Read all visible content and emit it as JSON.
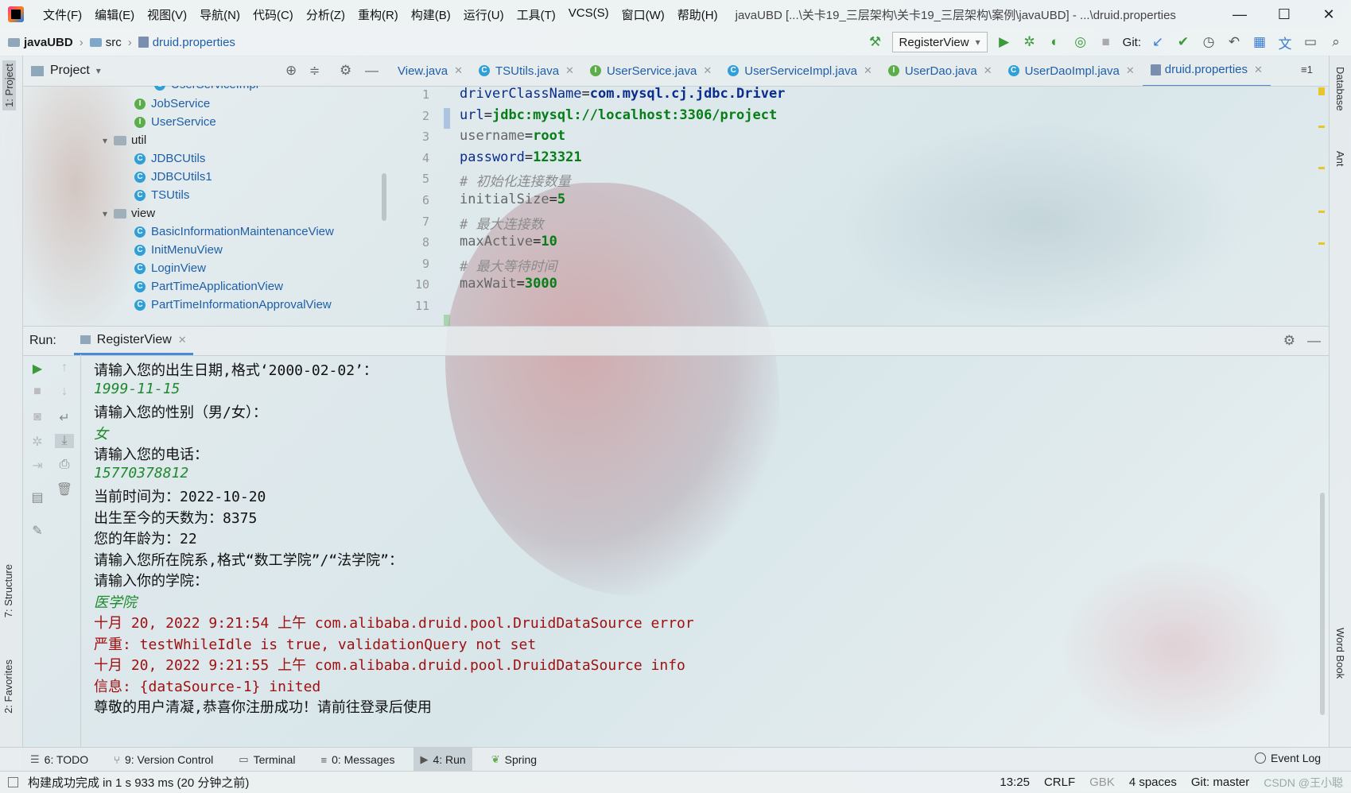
{
  "titlebar": {
    "menus": [
      "文件(F)",
      "编辑(E)",
      "视图(V)",
      "导航(N)",
      "代码(C)",
      "分析(Z)",
      "重构(R)",
      "构建(B)",
      "运行(U)",
      "工具(T)",
      "VCS(S)",
      "窗口(W)",
      "帮助(H)"
    ],
    "title": "javaUBD [...\\关卡19_三层架构\\关卡19_三层架构\\案例\\javaUBD] - ...\\druid.properties"
  },
  "navbar": {
    "project": "javaUBD",
    "folder": "src",
    "file": "druid.properties",
    "run_config": "RegisterView",
    "git_label": "Git:"
  },
  "project_panel": {
    "title": "Project",
    "tree": [
      {
        "label": "UserServiceImpl",
        "kind": "class"
      },
      {
        "label": "JobService",
        "kind": "interface"
      },
      {
        "label": "UserService",
        "kind": "interface"
      },
      {
        "label": "util",
        "kind": "package"
      },
      {
        "label": "JDBCUtils",
        "kind": "class"
      },
      {
        "label": "JDBCUtils1",
        "kind": "class"
      },
      {
        "label": "TSUtils",
        "kind": "class"
      },
      {
        "label": "view",
        "kind": "package"
      },
      {
        "label": "BasicInformationMaintenanceView",
        "kind": "class"
      },
      {
        "label": "InitMenuView",
        "kind": "class"
      },
      {
        "label": "LoginView",
        "kind": "class"
      },
      {
        "label": "PartTimeApplicationView",
        "kind": "class"
      },
      {
        "label": "PartTimeInformationApprovalView",
        "kind": "class"
      }
    ]
  },
  "editor": {
    "tabs": [
      {
        "label": "View.java",
        "kind": "none"
      },
      {
        "label": "TSUtils.java",
        "kind": "class"
      },
      {
        "label": "UserService.java",
        "kind": "interface"
      },
      {
        "label": "UserServiceImpl.java",
        "kind": "class"
      },
      {
        "label": "UserDao.java",
        "kind": "interface"
      },
      {
        "label": "UserDaoImpl.java",
        "kind": "class"
      },
      {
        "label": "druid.properties",
        "kind": "props",
        "active": true
      }
    ],
    "tab_overflow": "≡1",
    "lines": [
      {
        "n": "1",
        "key": "driverClassName",
        "val": "com.mysql.cj.jdbc.Driver",
        "comment": ""
      },
      {
        "n": "2",
        "key": "url",
        "val": "jdbc:mysql://localhost:3306/project",
        "comment": ""
      },
      {
        "n": "3",
        "key": "username",
        "val": "root",
        "comment": ""
      },
      {
        "n": "4",
        "key": "password",
        "val": "123321",
        "comment": ""
      },
      {
        "n": "5",
        "key": "",
        "val": "",
        "comment": "# 初始化连接数量"
      },
      {
        "n": "6",
        "key": "initialSize",
        "val": "5",
        "comment": ""
      },
      {
        "n": "7",
        "key": "",
        "val": "",
        "comment": "# 最大连接数"
      },
      {
        "n": "8",
        "key": "maxActive",
        "val": "10",
        "comment": ""
      },
      {
        "n": "9",
        "key": "",
        "val": "",
        "comment": "# 最大等待时间"
      },
      {
        "n": "10",
        "key": "maxWait",
        "val": "3000",
        "comment": ""
      },
      {
        "n": "11",
        "key": "",
        "val": "",
        "comment": ""
      }
    ]
  },
  "run_panel": {
    "label": "Run:",
    "tab": "RegisterView",
    "console": [
      {
        "text": "请输入您的出生日期,格式‘2000-02-02’：",
        "style": "out"
      },
      {
        "text": "1999-11-15",
        "style": "inp"
      },
      {
        "text": "请输入您的性别（男/女）：",
        "style": "out"
      },
      {
        "text": "女",
        "style": "inp"
      },
      {
        "text": "请输入您的电话：",
        "style": "out"
      },
      {
        "text": "15770378812",
        "style": "inp"
      },
      {
        "text": "当前时间为：2022-10-20",
        "style": "out"
      },
      {
        "text": "出生至今的天数为：8375",
        "style": "out"
      },
      {
        "text": "您的年龄为：22",
        "style": "out"
      },
      {
        "text": "请输入您所在院系,格式“数工学院”/“法学院”：",
        "style": "out"
      },
      {
        "text": "请输入你的学院：",
        "style": "out"
      },
      {
        "text": "医学院",
        "style": "inp"
      },
      {
        "text": "十月 20, 2022 9:21:54 上午 com.alibaba.druid.pool.DruidDataSource error",
        "style": "err"
      },
      {
        "text": "严重: testWhileIdle is true, validationQuery not set",
        "style": "err"
      },
      {
        "text": "十月 20, 2022 9:21:55 上午 com.alibaba.druid.pool.DruidDataSource info",
        "style": "err"
      },
      {
        "text": "信息: {dataSource-1} inited",
        "style": "err"
      },
      {
        "text": "尊敬的用户清凝,恭喜你注册成功！请前往登录后使用",
        "style": "out"
      }
    ]
  },
  "side_tabs": {
    "left": [
      "1: Project",
      "7: Structure",
      "2: Favorites"
    ],
    "right": [
      "Database",
      "Ant",
      "Word Book"
    ]
  },
  "bottom_tools": [
    {
      "label": "6: TODO",
      "icon": "list-icon"
    },
    {
      "label": "9: Version Control",
      "icon": "branch-icon"
    },
    {
      "label": "Terminal",
      "icon": "terminal-icon"
    },
    {
      "label": "0: Messages",
      "icon": "messages-icon"
    },
    {
      "label": "4: Run",
      "icon": "run-icon",
      "active": true
    },
    {
      "label": "Spring",
      "icon": "spring-icon"
    }
  ],
  "event_log": "Event Log",
  "status": {
    "message": "构建成功完成 in 1 s 933 ms (20 分钟之前)",
    "position": "13:25",
    "line_sep": "CRLF",
    "encoding": "GBK",
    "indent": "4 spaces",
    "git": "Git: master",
    "watermark": "CSDN @王小聪"
  }
}
